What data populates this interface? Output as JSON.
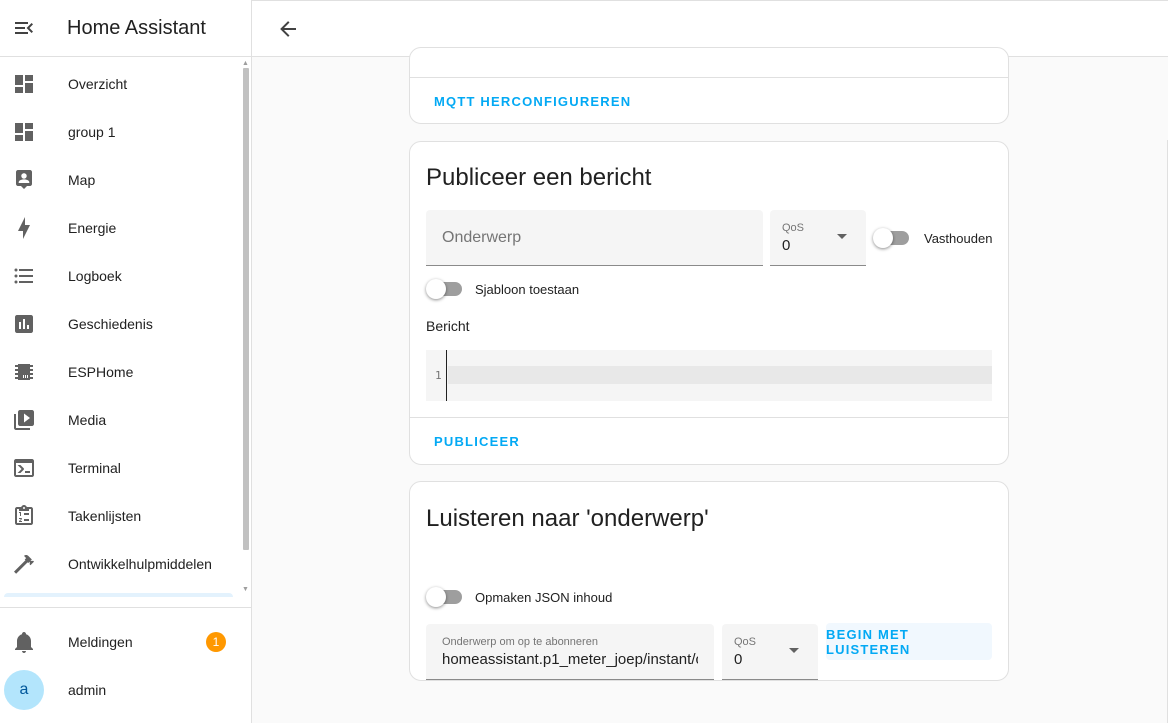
{
  "app": {
    "title": "Home Assistant"
  },
  "sidebar": {
    "items": [
      {
        "label": "Overzicht",
        "icon": "dashboard-icon"
      },
      {
        "label": "group 1",
        "icon": "dashboard-icon"
      },
      {
        "label": "Map",
        "icon": "map-icon"
      },
      {
        "label": "Energie",
        "icon": "lightning-icon"
      },
      {
        "label": "Logboek",
        "icon": "list-icon"
      },
      {
        "label": "Geschiedenis",
        "icon": "chart-icon"
      },
      {
        "label": "ESPHome",
        "icon": "chip-icon"
      },
      {
        "label": "Media",
        "icon": "play-box-icon"
      },
      {
        "label": "Terminal",
        "icon": "console-icon"
      },
      {
        "label": "Takenlijsten",
        "icon": "clipboard-list-icon"
      },
      {
        "label": "Ontwikkelhulpmiddelen",
        "icon": "hammer-icon"
      }
    ],
    "notifications": {
      "label": "Meldingen",
      "count": "1"
    },
    "user": {
      "label": "admin",
      "initial": "a"
    }
  },
  "mqtt_card": {
    "action": "MQTT HERCONFIGUREREN"
  },
  "publish_card": {
    "title": "Publiceer een bericht",
    "topic_placeholder": "Onderwerp",
    "qos_label": "QoS",
    "qos_value": "0",
    "retain_label": "Vasthouden",
    "template_label": "Sjabloon toestaan",
    "payload_label": "Bericht",
    "editor_line": "1",
    "action": "PUBLICEER"
  },
  "listen_card": {
    "title": "Luisteren naar 'onderwerp'",
    "format_json_label": "Opmaken JSON inhoud",
    "topic_label": "Onderwerp om op te abonneren",
    "topic_value": "homeassistant.p1_meter_joep/instant/c",
    "qos_label": "QoS",
    "qos_value": "0",
    "action": "BEGIN MET LUISTEREN"
  },
  "colors": {
    "accent": "#03a9f4",
    "badge": "#ff9800",
    "avatar": "#b3e5fc"
  }
}
